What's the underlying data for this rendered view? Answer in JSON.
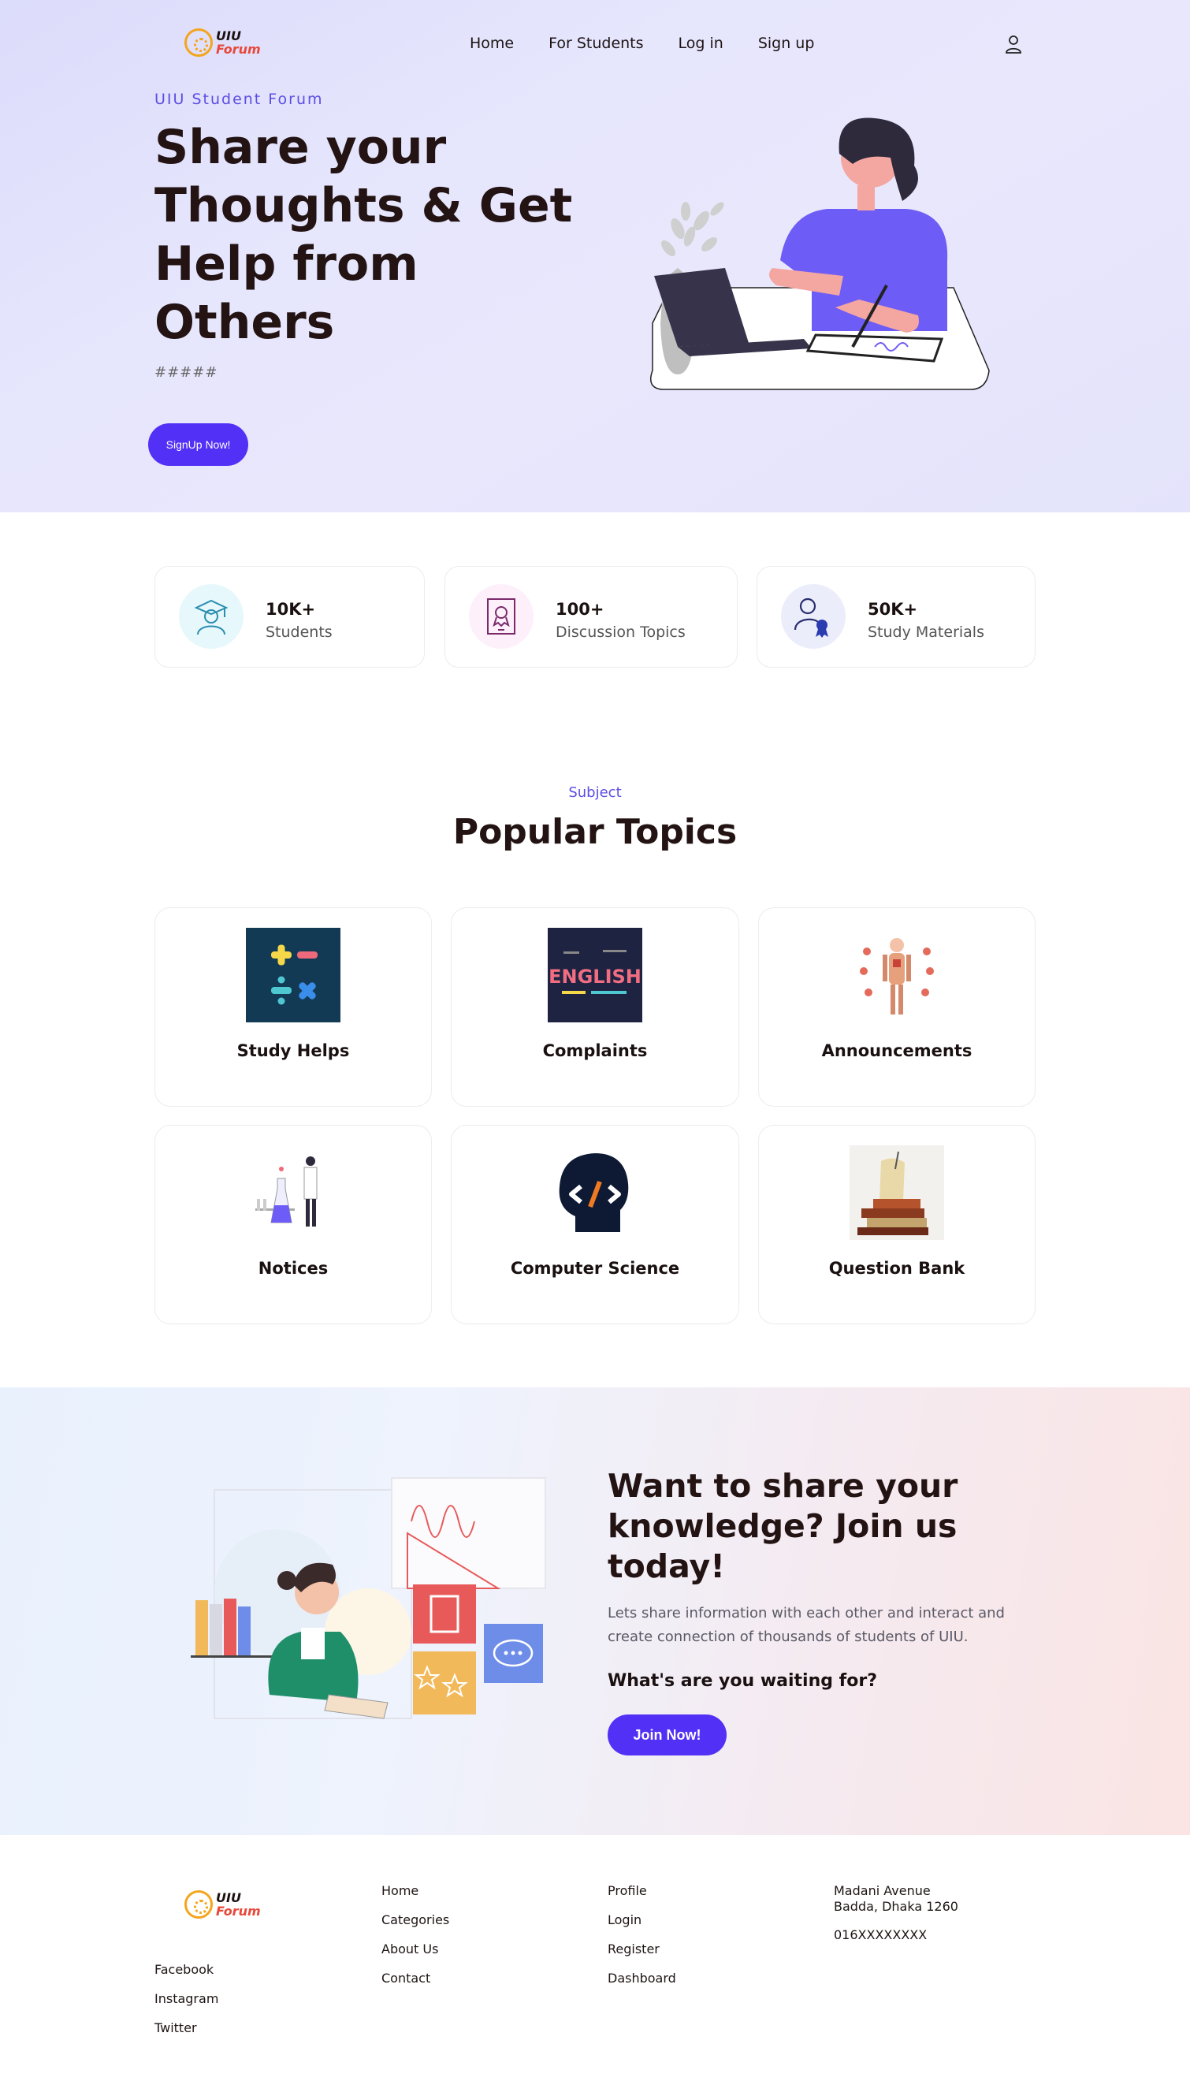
{
  "brand": {
    "line1": "UIU",
    "line2": "Forum"
  },
  "nav": {
    "links": [
      "Home",
      "For Students",
      "Log in",
      "Sign up"
    ]
  },
  "hero": {
    "eyebrow": "UIU Student Forum",
    "title": "Share your Thoughts & Get Help from Others",
    "subtitle": "#####",
    "cta": "SignUp Now!"
  },
  "stats": [
    {
      "value": "10K+",
      "label": "Students",
      "icon": "graduate-icon"
    },
    {
      "value": "100+",
      "label": "Discussion Topics",
      "icon": "certificate-icon"
    },
    {
      "value": "50K+",
      "label": "Study Materials",
      "icon": "award-user-icon"
    }
  ],
  "topics_section": {
    "eyebrow": "Subject",
    "title": "Popular Topics",
    "topics": [
      {
        "label": "Study Helps"
      },
      {
        "label": "Complaints"
      },
      {
        "label": "Announcements"
      },
      {
        "label": "Notices"
      },
      {
        "label": "Computer Science"
      },
      {
        "label": "Question Bank"
      }
    ]
  },
  "join": {
    "title": "Want to share your knowledge? Join us today!",
    "description": "Lets share information with each other and interact and create connection of thousands of students of UIU.",
    "question": "What's are you waiting for?",
    "button": "Join Now!"
  },
  "footer": {
    "social": [
      "Facebook",
      "Instagram",
      "Twitter"
    ],
    "col2": [
      "Home",
      "Categories",
      "About Us",
      "Contact"
    ],
    "col3": [
      "Profile",
      "Login",
      "Register",
      "Dashboard"
    ],
    "address_line1": "Madani Avenue",
    "address_line2": "Badda, Dhaka 1260",
    "phone": "016XXXXXXXX"
  },
  "colors": {
    "accent": "#5230f5",
    "eyebrow": "#5b4ee5",
    "heading": "#231313",
    "logo_accent": "#e8483a",
    "logo_ring": "#f3a51c"
  }
}
